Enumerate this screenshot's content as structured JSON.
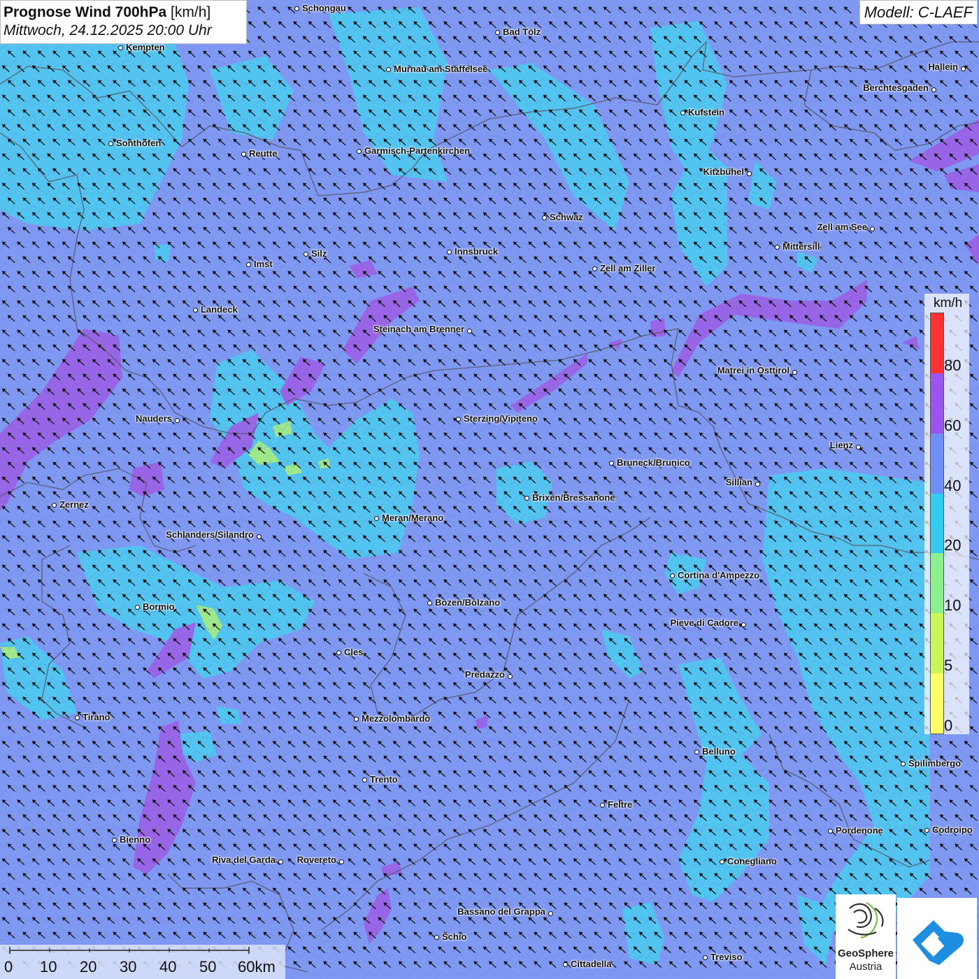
{
  "title": {
    "main_bold": "Prognose Wind 700hPa",
    "main_unit": "[km/h]",
    "datetime": "Mittwoch, 24.12.2025 20:00 Uhr"
  },
  "model": "Modell: C-LAEF",
  "cities": [
    {
      "name": "Schongau",
      "label_side": "right"
    },
    {
      "name": "Bad Tölz",
      "label_side": "right"
    },
    {
      "name": "Kempten",
      "label_side": "right"
    },
    {
      "name": "Murnau am Staffelsee",
      "label_side": "right"
    },
    {
      "name": "Hallein",
      "label_side": "left"
    },
    {
      "name": "Berchtesgaden",
      "label_side": "left"
    },
    {
      "name": "Kufstein",
      "label_side": "right"
    },
    {
      "name": "Sonthofen",
      "label_side": "right"
    },
    {
      "name": "Reutte",
      "label_side": "right"
    },
    {
      "name": "Garmisch-Partenkirchen",
      "label_side": "right"
    },
    {
      "name": "Kitzbühel",
      "label_side": "left"
    },
    {
      "name": "Schwaz",
      "label_side": "right"
    },
    {
      "name": "Zell am See",
      "label_side": "left"
    },
    {
      "name": "Mittersill",
      "label_side": "right"
    },
    {
      "name": "Silz",
      "label_side": "right"
    },
    {
      "name": "Innsbruck",
      "label_side": "right"
    },
    {
      "name": "Imst",
      "label_side": "right"
    },
    {
      "name": "Zell am Ziller",
      "label_side": "right"
    },
    {
      "name": "Landeck",
      "label_side": "right"
    },
    {
      "name": "Steinach am Brenner",
      "label_side": "left"
    },
    {
      "name": "Matrei in Osttirol",
      "label_side": "left"
    },
    {
      "name": "Nauders",
      "label_side": "left"
    },
    {
      "name": "Sterzing/Vipiteno",
      "label_side": "right"
    },
    {
      "name": "Lienz",
      "label_side": "left"
    },
    {
      "name": "Bruneck/Brunico",
      "label_side": "right"
    },
    {
      "name": "Sillian",
      "label_side": "left"
    },
    {
      "name": "Brixen/Bressanone",
      "label_side": "right"
    },
    {
      "name": "Zernez",
      "label_side": "right"
    },
    {
      "name": "Meran/Merano",
      "label_side": "right"
    },
    {
      "name": "Schlanders/Silandro",
      "label_side": "left"
    },
    {
      "name": "Cortina d'Ampezzo",
      "label_side": "right"
    },
    {
      "name": "Bozen/Bolzano",
      "label_side": "right"
    },
    {
      "name": "Bormio",
      "label_side": "right"
    },
    {
      "name": "Pieve di Cadore",
      "label_side": "left"
    },
    {
      "name": "Cles",
      "label_side": "right"
    },
    {
      "name": "Predazzo",
      "label_side": "left"
    },
    {
      "name": "Tirano",
      "label_side": "right"
    },
    {
      "name": "Mezzolombardo",
      "label_side": "right"
    },
    {
      "name": "Belluno",
      "label_side": "right"
    },
    {
      "name": "Spilimbergo",
      "label_side": "right"
    },
    {
      "name": "Trento",
      "label_side": "right"
    },
    {
      "name": "Feltre",
      "label_side": "right"
    },
    {
      "name": "Pordenone",
      "label_side": "right"
    },
    {
      "name": "Codroipo",
      "label_side": "right"
    },
    {
      "name": "Bienno",
      "label_side": "right"
    },
    {
      "name": "Riva del Garda",
      "label_side": "left"
    },
    {
      "name": "Rovereto",
      "label_side": "left"
    },
    {
      "name": "Conegliano",
      "label_side": "right"
    },
    {
      "name": "Bassano del Grappa",
      "label_side": "left"
    },
    {
      "name": "Schio",
      "label_side": "right"
    },
    {
      "name": "Treviso",
      "label_side": "right"
    },
    {
      "name": "Cittadella",
      "label_side": "right"
    }
  ],
  "legend": {
    "unit": "km/h",
    "classes": [
      {
        "label": "0",
        "color": "#ffff66"
      },
      {
        "label": "5",
        "color": "#ccf55a"
      },
      {
        "label": "10",
        "color": "#8cf08c"
      },
      {
        "label": "20",
        "color": "#33ccf0"
      },
      {
        "label": "40",
        "color": "#6f8ff7"
      },
      {
        "label": "60",
        "color": "#9955ee"
      },
      {
        "label": "80",
        "color": "#ff3333"
      }
    ]
  },
  "map_colors": {
    "background": "#7f98f2",
    "light_wind": "#4fc8f0",
    "strong_wind": "#9b62e6",
    "calm": "#9ee88a",
    "border": "#555566"
  },
  "wind_arrow_direction": "north-west",
  "scale_bar": {
    "ticks": [
      "0",
      "10",
      "20",
      "30",
      "40",
      "50",
      "60km"
    ]
  },
  "logos": {
    "geosphere_name": "GeoSphere",
    "geosphere_sub": "Austria",
    "app_icon": "cloud-arrow-icon"
  }
}
